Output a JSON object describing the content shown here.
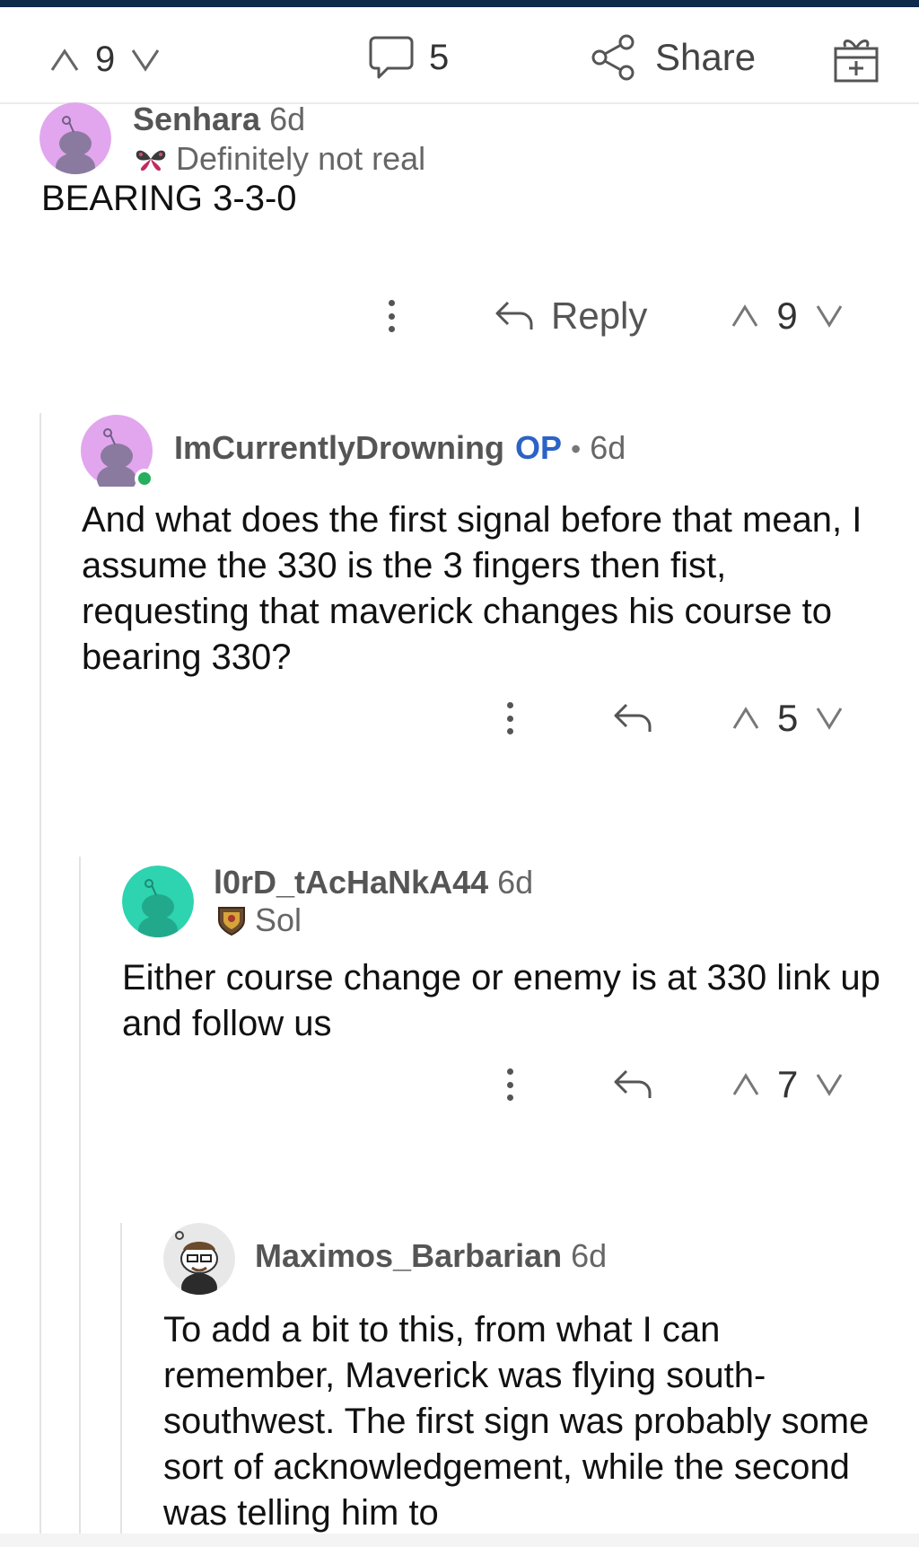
{
  "colors": {
    "accent": "#2b63c6",
    "online": "#27ae60",
    "thread_line": "#e3e3e3",
    "top_bar": "#0f2a4a"
  },
  "post_bar": {
    "upvote_count": "9",
    "comment_count": "5",
    "share_label": "Share",
    "icons": [
      "upvote-icon",
      "downvote-icon",
      "comment-bubble-icon",
      "share-icon",
      "award-gift-icon"
    ]
  },
  "comments": [
    {
      "username": "Senhara",
      "age": "6d",
      "flair": "Definitely not real",
      "body": "BEARING 3-3-0",
      "reply_label": "Reply",
      "votes": "9",
      "avatar_color": "#e2a6ee"
    },
    {
      "username": "ImCurrentlyDrowning",
      "op_label": "OP",
      "separator": "•",
      "age": "6d",
      "body": "And what does the first signal before that mean, I assume the 330 is the 3 fingers then fist, requesting that maverick changes his course to bearing 330?",
      "votes": "5",
      "avatar_color": "#e2a6ee",
      "online": true
    },
    {
      "username": "l0rD_tAcHaNkA44",
      "age": "6d",
      "flair": "Sol",
      "body": "Either course change or enemy is at 330 link up and follow us",
      "votes": "7",
      "avatar_color": "#2ed3b0"
    },
    {
      "username": "Maximos_Barbarian",
      "age": "6d",
      "body": "To add a bit to this, from what I can remember, Maverick was flying south-southwest. The first sign was probably some sort of acknowledgement, while the second was telling him to",
      "avatar_color": "#e8e8e8"
    }
  ]
}
